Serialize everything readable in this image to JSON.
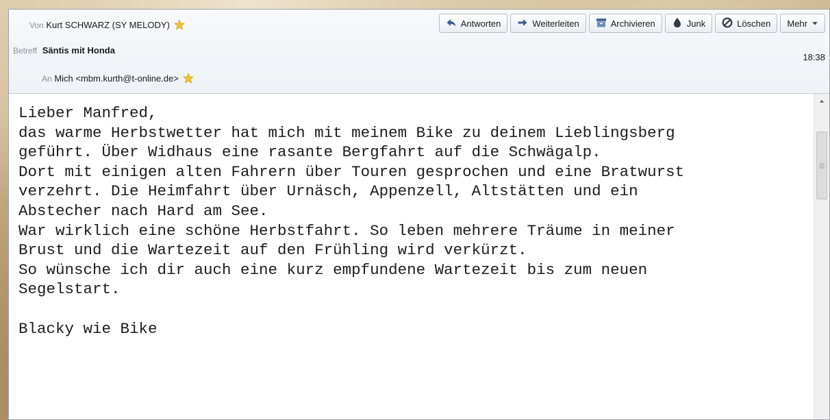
{
  "header": {
    "from_label": "Von",
    "from_name": "Kurt SCHWARZ  (SY MELODY)",
    "subject_label": "Betreff",
    "subject": "Säntis mit Honda",
    "to_label": "An",
    "to_value": "Mich <mbm.kurth@t-online.de>",
    "time": "18:38"
  },
  "toolbar": {
    "reply": "Antworten",
    "forward": "Weiterleiten",
    "archive": "Archivieren",
    "junk": "Junk",
    "delete": "Löschen",
    "more": "Mehr"
  },
  "message": {
    "lines": [
      "Lieber Manfred,",
      "das warme Herbstwetter hat mich mit meinem Bike zu deinem Lieblingsberg",
      "geführt. Über Widhaus eine rasante Bergfahrt auf die Schwägalp.",
      "Dort mit einigen alten Fahrern über Touren gesprochen und eine Bratwurst",
      "verzehrt. Die Heimfahrt über Urnäsch, Appenzell, Altstätten und ein",
      "Abstecher nach Hard am See.",
      "War wirklich eine schöne Herbstfahrt. So leben mehrere Träume in meiner",
      "Brust und die Wartezeit auf den Frühling wird verkürzt.",
      "So wünsche ich dir auch eine kurz empfundene Wartezeit bis zum neuen",
      "Segelstart.",
      "",
      "Blacky wie Bike"
    ]
  },
  "colors": {
    "star": "#f2c230",
    "header_bg": "#eef2f6",
    "text": "#1c1c1c"
  }
}
